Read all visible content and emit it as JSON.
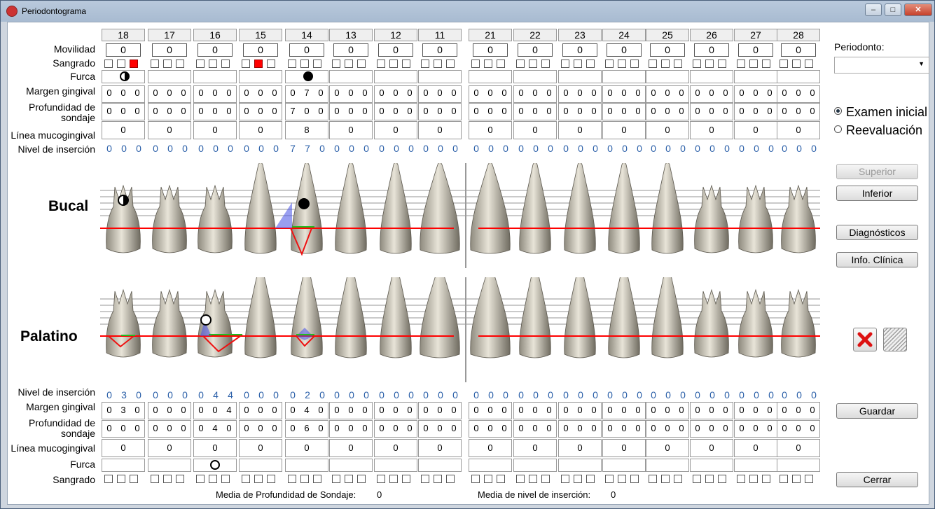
{
  "window": {
    "title": "Periodontograma",
    "min": "–",
    "max": "□",
    "close": "✕"
  },
  "upper_teeth_left": [
    "18",
    "17",
    "16",
    "15",
    "14",
    "13",
    "12",
    "11"
  ],
  "upper_teeth_right": [
    "21",
    "22",
    "23",
    "24",
    "25",
    "26",
    "27",
    "28"
  ],
  "labels": {
    "movilidad": "Movilidad",
    "sangrado": "Sangrado",
    "furca": "Furca",
    "margen": "Margen gingival",
    "profundidad": "Profundidad de sondaje",
    "linea": "Línea mucogingival",
    "nivel": "Nivel de inserción",
    "bucal": "Bucal",
    "palatino": "Palatino"
  },
  "upper": {
    "movilidad": [
      "0",
      "0",
      "0",
      "0",
      "0",
      "0",
      "0",
      "0",
      "0",
      "0",
      "0",
      "0",
      "0",
      "0",
      "0",
      "0"
    ],
    "sangrado_red": [
      [
        0,
        2
      ],
      [
        3,
        1
      ]
    ],
    "furca": [
      {
        "tooth": 0,
        "type": "half"
      },
      {
        "tooth": 4,
        "type": "full"
      }
    ],
    "margen": [
      [
        "0",
        "0",
        "0"
      ],
      [
        "0",
        "0",
        "0"
      ],
      [
        "0",
        "0",
        "0"
      ],
      [
        "0",
        "0",
        "0"
      ],
      [
        "0",
        "7",
        "0"
      ],
      [
        "0",
        "0",
        "0"
      ],
      [
        "0",
        "0",
        "0"
      ],
      [
        "0",
        "0",
        "0"
      ],
      [
        "0",
        "0",
        "0"
      ],
      [
        "0",
        "0",
        "0"
      ],
      [
        "0",
        "0",
        "0"
      ],
      [
        "0",
        "0",
        "0"
      ],
      [
        "0",
        "0",
        "0"
      ],
      [
        "0",
        "0",
        "0"
      ],
      [
        "0",
        "0",
        "0"
      ],
      [
        "0",
        "0",
        "0"
      ]
    ],
    "profundidad": [
      [
        "0",
        "0",
        "0"
      ],
      [
        "0",
        "0",
        "0"
      ],
      [
        "0",
        "0",
        "0"
      ],
      [
        "0",
        "0",
        "0"
      ],
      [
        "7",
        "0",
        "0"
      ],
      [
        "0",
        "0",
        "0"
      ],
      [
        "0",
        "0",
        "0"
      ],
      [
        "0",
        "0",
        "0"
      ],
      [
        "0",
        "0",
        "0"
      ],
      [
        "0",
        "0",
        "0"
      ],
      [
        "0",
        "0",
        "0"
      ],
      [
        "0",
        "0",
        "0"
      ],
      [
        "0",
        "0",
        "0"
      ],
      [
        "0",
        "0",
        "0"
      ],
      [
        "0",
        "0",
        "0"
      ],
      [
        "0",
        "0",
        "0"
      ]
    ],
    "linea": [
      "0",
      "0",
      "0",
      "0",
      "8",
      "0",
      "0",
      "0",
      "0",
      "0",
      "0",
      "0",
      "0",
      "0",
      "0",
      "0"
    ],
    "nivel": [
      [
        "0",
        "0",
        "0"
      ],
      [
        "0",
        "0",
        "0"
      ],
      [
        "0",
        "0",
        "0"
      ],
      [
        "0",
        "0",
        "0"
      ],
      [
        "7",
        "7",
        "0"
      ],
      [
        "0",
        "0",
        "0"
      ],
      [
        "0",
        "0",
        "0"
      ],
      [
        "0",
        "0",
        "0"
      ],
      [
        "0",
        "0",
        "0"
      ],
      [
        "0",
        "0",
        "0"
      ],
      [
        "0",
        "0",
        "0"
      ],
      [
        "0",
        "0",
        "0"
      ],
      [
        "0",
        "0",
        "0"
      ],
      [
        "0",
        "0",
        "0"
      ],
      [
        "0",
        "0",
        "0"
      ],
      [
        "0",
        "0",
        "0"
      ]
    ]
  },
  "lower": {
    "nivel": [
      [
        "0",
        "3",
        "0"
      ],
      [
        "0",
        "0",
        "0"
      ],
      [
        "0",
        "4",
        "4"
      ],
      [
        "0",
        "0",
        "0"
      ],
      [
        "0",
        "2",
        "0"
      ],
      [
        "0",
        "0",
        "0"
      ],
      [
        "0",
        "0",
        "0"
      ],
      [
        "0",
        "0",
        "0"
      ],
      [
        "0",
        "0",
        "0"
      ],
      [
        "0",
        "0",
        "0"
      ],
      [
        "0",
        "0",
        "0"
      ],
      [
        "0",
        "0",
        "0"
      ],
      [
        "0",
        "0",
        "0"
      ],
      [
        "0",
        "0",
        "0"
      ],
      [
        "0",
        "0",
        "0"
      ],
      [
        "0",
        "0",
        "0"
      ]
    ],
    "margen": [
      [
        "0",
        "3",
        "0"
      ],
      [
        "0",
        "0",
        "0"
      ],
      [
        "0",
        "0",
        "4"
      ],
      [
        "0",
        "0",
        "0"
      ],
      [
        "0",
        "4",
        "0"
      ],
      [
        "0",
        "0",
        "0"
      ],
      [
        "0",
        "0",
        "0"
      ],
      [
        "0",
        "0",
        "0"
      ],
      [
        "0",
        "0",
        "0"
      ],
      [
        "0",
        "0",
        "0"
      ],
      [
        "0",
        "0",
        "0"
      ],
      [
        "0",
        "0",
        "0"
      ],
      [
        "0",
        "0",
        "0"
      ],
      [
        "0",
        "0",
        "0"
      ],
      [
        "0",
        "0",
        "0"
      ],
      [
        "0",
        "0",
        "0"
      ]
    ],
    "profundidad": [
      [
        "0",
        "0",
        "0"
      ],
      [
        "0",
        "0",
        "0"
      ],
      [
        "0",
        "4",
        "0"
      ],
      [
        "0",
        "0",
        "0"
      ],
      [
        "0",
        "6",
        "0"
      ],
      [
        "0",
        "0",
        "0"
      ],
      [
        "0",
        "0",
        "0"
      ],
      [
        "0",
        "0",
        "0"
      ],
      [
        "0",
        "0",
        "0"
      ],
      [
        "0",
        "0",
        "0"
      ],
      [
        "0",
        "0",
        "0"
      ],
      [
        "0",
        "0",
        "0"
      ],
      [
        "0",
        "0",
        "0"
      ],
      [
        "0",
        "0",
        "0"
      ],
      [
        "0",
        "0",
        "0"
      ],
      [
        "0",
        "0",
        "0"
      ]
    ],
    "linea": [
      "0",
      "0",
      "0",
      "0",
      "0",
      "0",
      "0",
      "0",
      "0",
      "0",
      "0",
      "0",
      "0",
      "0",
      "0",
      "0"
    ],
    "furca": [
      {
        "tooth": 2,
        "type": "empty"
      }
    ]
  },
  "side": {
    "periodonto_label": "Periodonto:",
    "periodonto_value": "",
    "radio_inicial": "Examen inicial",
    "radio_reeval": "Reevaluación",
    "btn_superior": "Superior",
    "btn_inferior": "Inferior",
    "btn_diagnosticos": "Diagnósticos",
    "btn_info": "Info. Clínica",
    "btn_guardar": "Guardar",
    "btn_cerrar": "Cerrar"
  },
  "footer": {
    "media_prof_label": "Media de Profundidad de Sondaje:",
    "media_prof_value": "0",
    "media_nivel_label": "Media de nivel de inserción:",
    "media_nivel_value": "0"
  },
  "colors": {
    "red": "#ff0000",
    "green": "#22bb22",
    "blue": "#4455dd",
    "insertion_blue": "#2a5fa8"
  }
}
